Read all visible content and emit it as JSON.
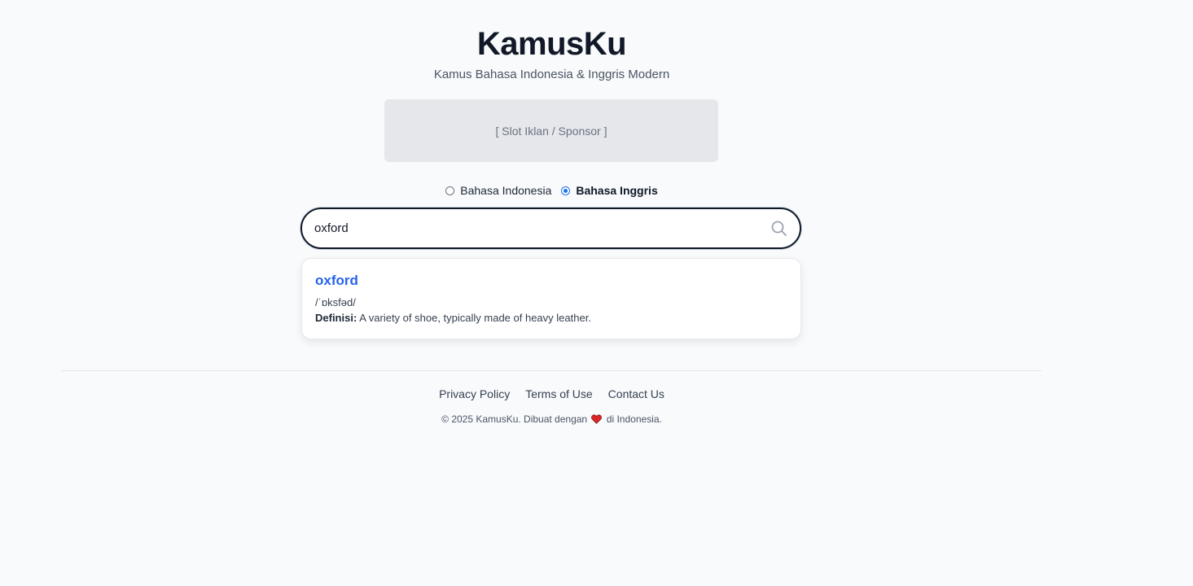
{
  "header": {
    "title": "KamusKu",
    "subtitle": "Kamus Bahasa Indonesia & Inggris Modern"
  },
  "ad": {
    "label": "[ Slot Iklan / Sponsor ]"
  },
  "language": {
    "options": [
      {
        "label": "Bahasa Indonesia",
        "checked": false
      },
      {
        "label": "Bahasa Inggris",
        "checked": true
      }
    ]
  },
  "search": {
    "value": "oxford",
    "icon": "search-icon"
  },
  "results": [
    {
      "word": "oxford",
      "phonetic": "/ˈɒksfəd/",
      "definition_label": "Definisi:",
      "definition": "A variety of shoe, typically made of heavy leather."
    }
  ],
  "footer": {
    "links": [
      "Privacy Policy",
      "Terms of Use",
      "Contact Us"
    ],
    "copyright_before": "© 2025 KamusKu. Dibuat dengan",
    "copyright_after": "di Indonesia.",
    "heart_icon": "heart-icon"
  },
  "colors": {
    "accent": "#2563eb",
    "radio_accent": "#1a73e8",
    "background": "#f8fafc"
  }
}
